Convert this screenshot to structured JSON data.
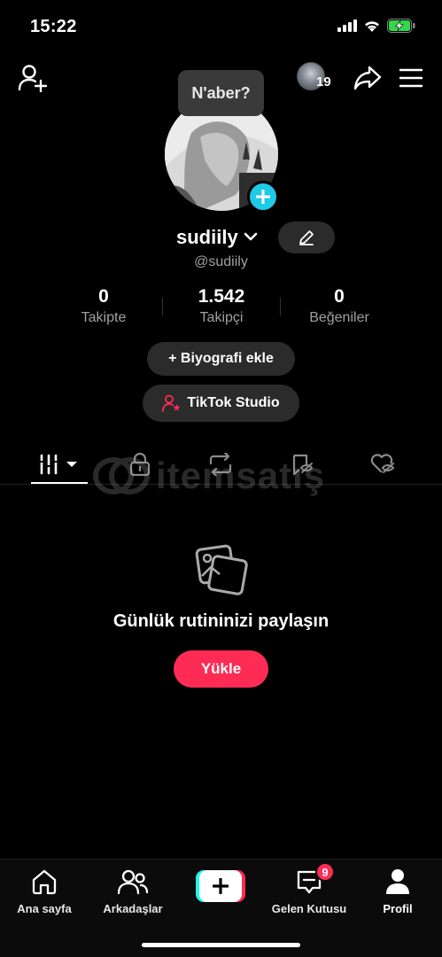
{
  "status_bar": {
    "time": "15:22"
  },
  "top_bar": {
    "story_count": "19",
    "bubble_text": "N'aber?"
  },
  "profile": {
    "username": "sudiily",
    "handle": "@sudiily",
    "stats": [
      {
        "value": "0",
        "label": "Takipte"
      },
      {
        "value": "1.542",
        "label": "Takipçi"
      },
      {
        "value": "0",
        "label": "Beğeniler"
      }
    ],
    "bio_button": "+ Biyografi ekle",
    "studio_button": "TikTok Studio"
  },
  "watermark": {
    "text": "itemsatış"
  },
  "empty_state": {
    "title": "Günlük rutininizi paylaşın",
    "upload_button": "Yükle"
  },
  "bottom_nav": {
    "items": [
      {
        "label": "Ana sayfa",
        "icon": "home-icon"
      },
      {
        "label": "Arkadaşlar",
        "icon": "friends-icon"
      },
      {
        "label": "",
        "icon": "create-icon"
      },
      {
        "label": "Gelen Kutusu",
        "icon": "inbox-icon"
      },
      {
        "label": "Profil",
        "icon": "profile-icon"
      }
    ],
    "inbox_badge": "9"
  },
  "colors": {
    "accent": "#fe2c55",
    "cyan": "#25f4ee",
    "add_badge": "#20c9e8",
    "background": "#000000"
  }
}
